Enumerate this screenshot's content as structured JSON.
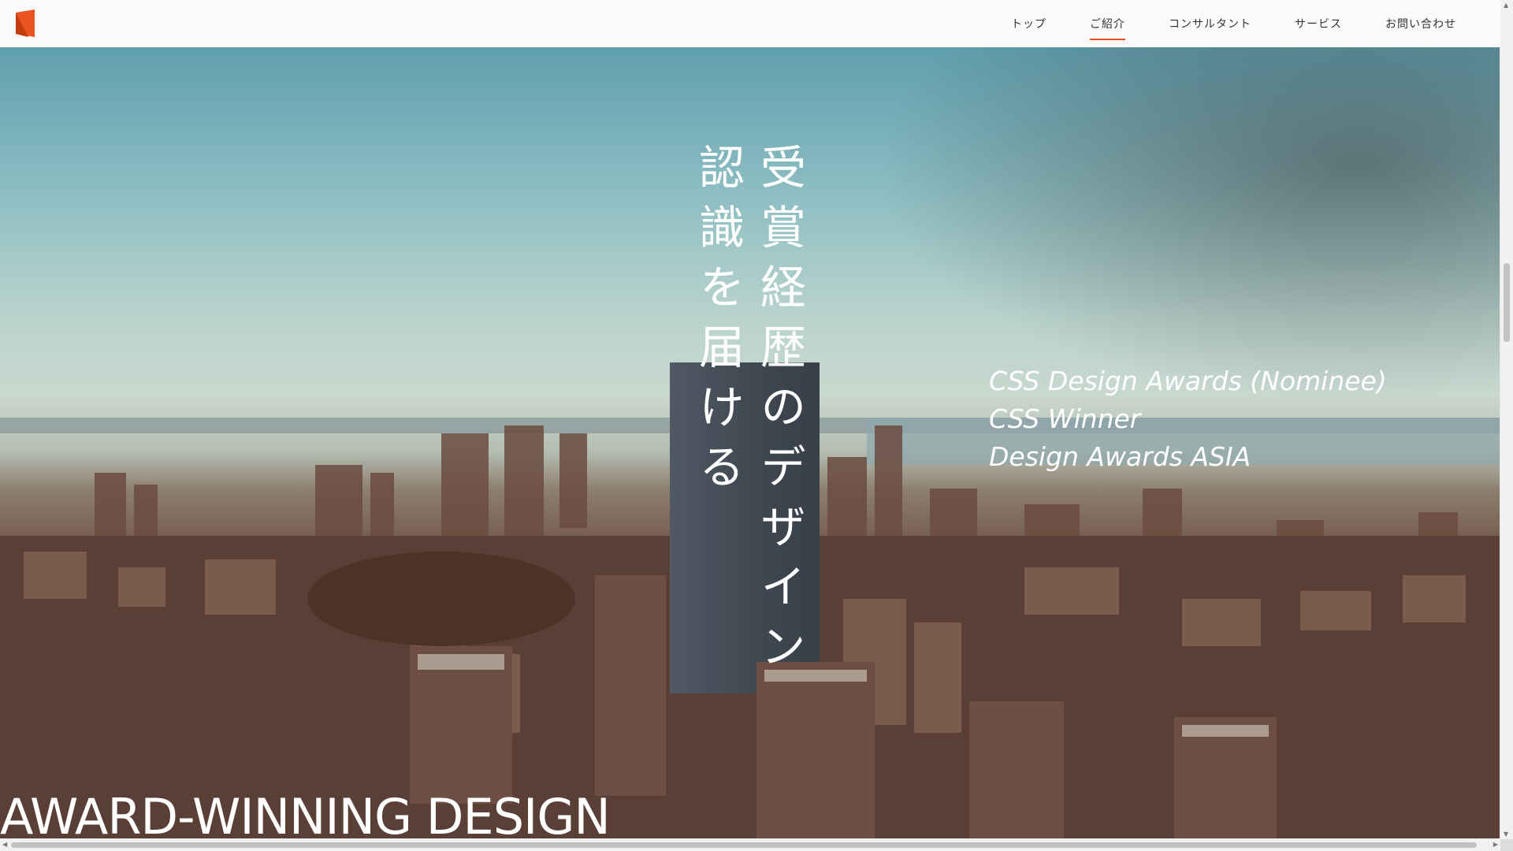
{
  "header": {
    "logo_icon": "brand-logo-icon",
    "nav": [
      {
        "label": "トップ",
        "active": false
      },
      {
        "label": "ご紹介",
        "active": true
      },
      {
        "label": "コンサルタント",
        "active": false
      },
      {
        "label": "サービス",
        "active": false
      },
      {
        "label": "お問い合わせ",
        "active": false
      }
    ]
  },
  "hero": {
    "vertical_line_1": "受賞経歴のデザイン",
    "vertical_line_2": "認識を届ける",
    "awards": [
      "CSS Design Awards (Nominee)",
      "CSS Winner",
      "Design Awards ASIA"
    ],
    "title": "AWARD-WINNING DESIGN"
  },
  "colors": {
    "accent": "#e8531f",
    "text_light": "#ffffff",
    "nav_text": "#333333"
  }
}
